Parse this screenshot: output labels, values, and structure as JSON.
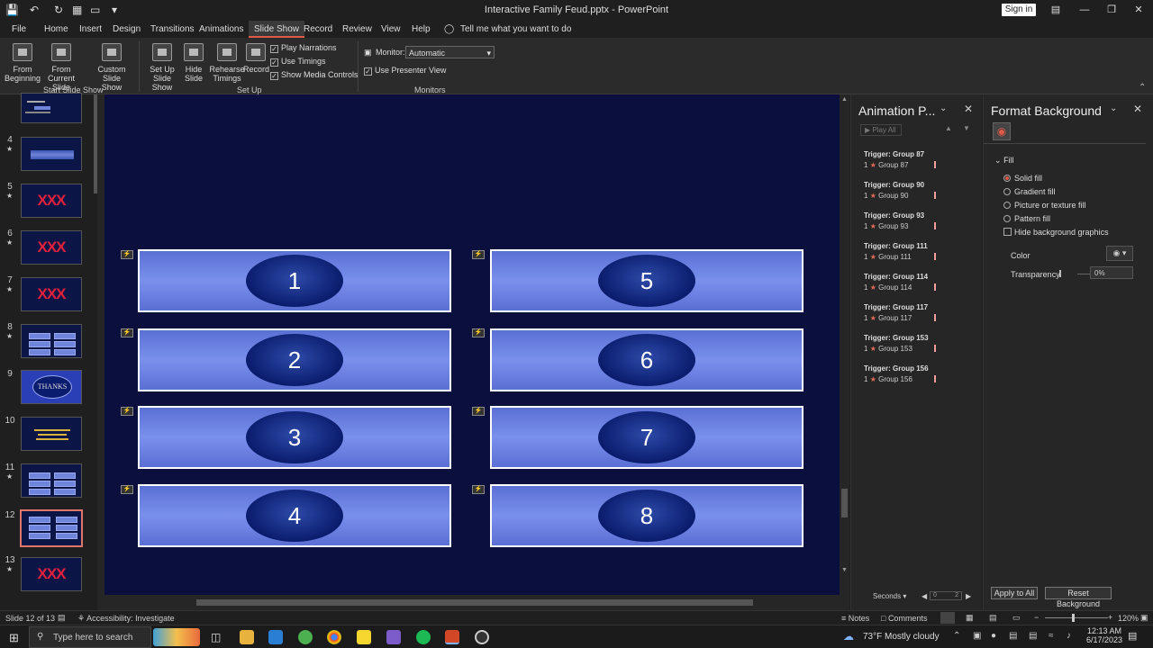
{
  "window": {
    "title": "Interactive Family Feud.pptx  -  PowerPoint",
    "sign_in": "Sign in"
  },
  "menu": {
    "items": [
      "File",
      "Home",
      "Insert",
      "Design",
      "Transitions",
      "Animations",
      "Slide Show",
      "Record",
      "Review",
      "View",
      "Help"
    ],
    "active": "Slide Show",
    "tell_me": "Tell me what you want to do"
  },
  "ribbon": {
    "from_beginning": "From\nBeginning",
    "from_current": "From\nCurrent Slide",
    "custom_show": "Custom Slide\nShow",
    "group_start": "Start Slide Show",
    "set_up": "Set Up\nSlide Show",
    "hide_slide": "Hide\nSlide",
    "rehearse": "Rehearse\nTimings",
    "record": "Record",
    "play_narrations": "Play Narrations",
    "use_timings": "Use Timings",
    "show_media_controls": "Show Media Controls",
    "group_setup": "Set Up",
    "monitor_label": "Monitor:",
    "monitor_value": "Automatic",
    "use_presenter_view": "Use Presenter View",
    "group_monitors": "Monitors"
  },
  "thumbnails": {
    "slides": [
      {
        "num": "",
        "star": false,
        "kind": "title",
        "label": ""
      },
      {
        "num": "4",
        "star": true,
        "kind": "blue",
        "label": ""
      },
      {
        "num": "5",
        "star": true,
        "kind": "xxx",
        "label": "XXX"
      },
      {
        "num": "6",
        "star": true,
        "kind": "xxx",
        "label": "XXX"
      },
      {
        "num": "7",
        "star": true,
        "kind": "xxx",
        "label": "XXX"
      },
      {
        "num": "8",
        "star": true,
        "kind": "board",
        "label": ""
      },
      {
        "num": "9",
        "star": false,
        "kind": "thanks",
        "label": "THANKS"
      },
      {
        "num": "10",
        "star": false,
        "kind": "text",
        "label": ""
      },
      {
        "num": "11",
        "star": true,
        "kind": "board",
        "label": ""
      },
      {
        "num": "12",
        "star": false,
        "kind": "board",
        "label": "",
        "selected": true
      },
      {
        "num": "13",
        "star": true,
        "kind": "xxx",
        "label": "XXX"
      }
    ]
  },
  "slide": {
    "tiles": [
      "1",
      "2",
      "3",
      "4",
      "5",
      "6",
      "7",
      "8"
    ]
  },
  "animation_pane": {
    "title": "Animation P...",
    "play_all": "Play All",
    "triggers": [
      {
        "trigger": "Trigger: Group 87",
        "item": "Group 87",
        "index": "1"
      },
      {
        "trigger": "Trigger: Group 90",
        "item": "Group 90",
        "index": "1"
      },
      {
        "trigger": "Trigger: Group 93",
        "item": "Group 93",
        "index": "1"
      },
      {
        "trigger": "Trigger: Group 111",
        "item": "Group 111",
        "index": "1"
      },
      {
        "trigger": "Trigger: Group 114",
        "item": "Group 114",
        "index": "1"
      },
      {
        "trigger": "Trigger: Group 117",
        "item": "Group 117",
        "index": "1"
      },
      {
        "trigger": "Trigger: Group 153",
        "item": "Group 153",
        "index": "1"
      },
      {
        "trigger": "Trigger: Group 156",
        "item": "Group 156",
        "index": "1"
      }
    ],
    "seconds": "Seconds",
    "timeline": [
      "0",
      "2"
    ]
  },
  "format_pane": {
    "title": "Format Background",
    "section": "Fill",
    "options": [
      "Solid fill",
      "Gradient fill",
      "Picture or texture fill",
      "Pattern fill"
    ],
    "selected_option": "Solid fill",
    "hide_bg": "Hide background graphics",
    "color_label": "Color",
    "transparency_label": "Transparency",
    "transparency_value": "0%",
    "apply_all": "Apply to All",
    "reset_bg": "Reset Background"
  },
  "status": {
    "slide_of": "Slide 12 of 13",
    "accessibility": "Accessibility: Investigate",
    "notes": "Notes",
    "comments": "Comments",
    "zoom": "120%"
  },
  "taskbar": {
    "search_placeholder": "Type here to search",
    "weather": "73°F  Mostly cloudy",
    "time": "12:13 AM",
    "date": "6/17/2023"
  },
  "colors": {
    "accent": "#e05a46",
    "slide_bg": "#0a0f3d",
    "tile": "#6f85e0"
  }
}
